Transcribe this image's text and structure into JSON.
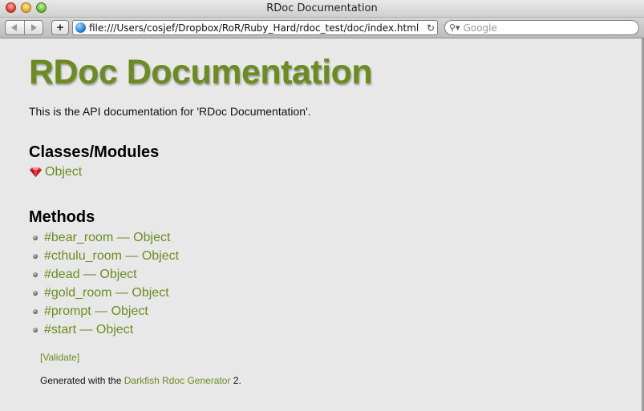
{
  "window": {
    "title": "RDoc Documentation"
  },
  "toolbar": {
    "back_icon": "back-arrow-icon",
    "forward_icon": "forward-arrow-icon",
    "add_bookmark_label": "+",
    "url": "file:///Users/cosjef/Dropbox/RoR/Ruby_Hard/rdoc_test/doc/index.html",
    "search_placeholder": "Google"
  },
  "page": {
    "title": "RDoc Documentation",
    "description": "This is the API documentation for 'RDoc Documentation'.",
    "classes_heading": "Classes/Modules",
    "classes": [
      {
        "label": "Object",
        "icon": "ruby-icon"
      }
    ],
    "methods_heading": "Methods",
    "methods": [
      {
        "label": "#bear_room — Object"
      },
      {
        "label": "#cthulu_room — Object"
      },
      {
        "label": "#dead — Object"
      },
      {
        "label": "#gold_room — Object"
      },
      {
        "label": "#prompt — Object"
      },
      {
        "label": "#start — Object"
      }
    ],
    "validate_label": "[Validate]",
    "footer": {
      "prefix": "Generated with the",
      "link_label": "Darkfish Rdoc Generator",
      "suffix": "2."
    }
  },
  "colors": {
    "accent": "#6c8c22",
    "background": "#e8e8e8"
  }
}
